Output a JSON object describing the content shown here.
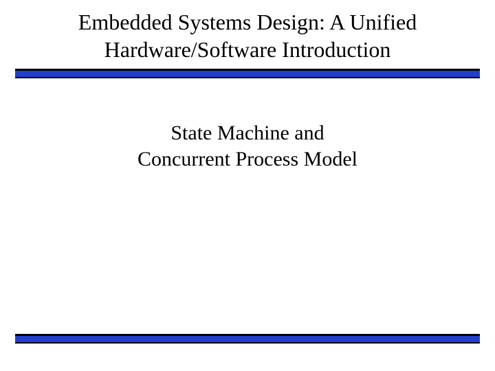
{
  "slide": {
    "header_title_line1": "Embedded Systems Design: A Unified",
    "header_title_line2": "Hardware/Software Introduction",
    "subtitle_line1": "State Machine and",
    "subtitle_line2": "Concurrent Process Model"
  },
  "colors": {
    "bar": "#2040d0",
    "text": "#000000",
    "background": "#ffffff"
  }
}
